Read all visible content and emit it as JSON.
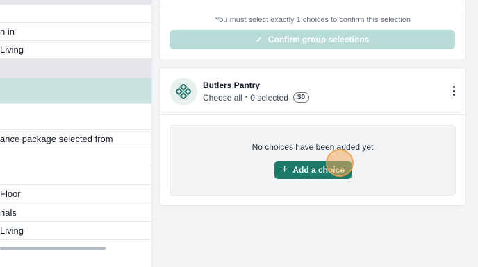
{
  "left_panel": {
    "rows": [
      {
        "text": ""
      },
      {
        "text": "n in"
      },
      {
        "text": "Living"
      },
      {
        "text": ""
      },
      {
        "text": ""
      },
      {
        "text": ""
      },
      {
        "text": "ance package selected from"
      },
      {
        "text": ""
      },
      {
        "text": ""
      },
      {
        "text": "Floor"
      },
      {
        "text": "rials"
      },
      {
        "text": "Living"
      }
    ]
  },
  "selection_card": {
    "hint": "You must select exactly 1 choices to confirm this selection",
    "confirm_label": "Confirm group selections"
  },
  "group": {
    "title": "Butlers Pantry",
    "mode": "Choose all",
    "separator": "•",
    "selected_text": "0 selected",
    "price": "$0",
    "empty_message": "No choices have been added yet",
    "add_label": "Add a choice"
  },
  "colors": {
    "accent": "#1c7a68",
    "confirm_disabled": "#b7dbd6",
    "selected_row": "#c9e4df",
    "header_row": "#e5e7eb"
  }
}
